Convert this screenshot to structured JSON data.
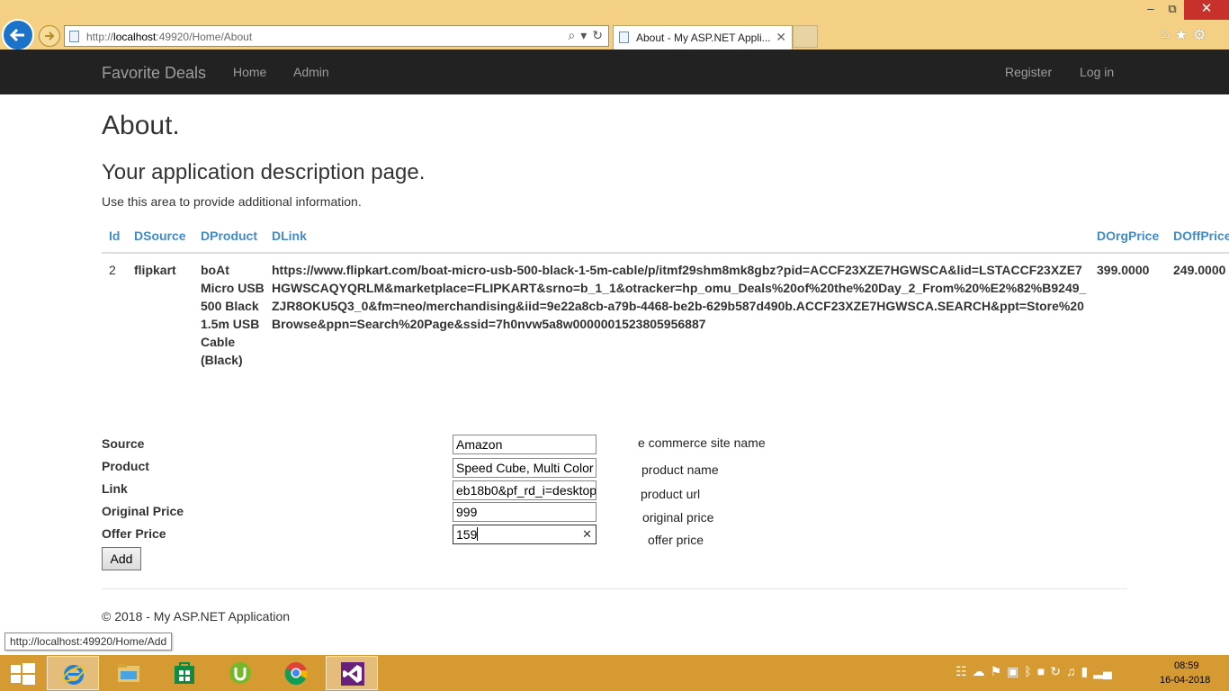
{
  "browser": {
    "url_prefix": "http://",
    "url_host": "localhost",
    "url_rest": ":49920/Home/About",
    "tab_title": "About - My ASP.NET Appli...",
    "status_url": "http://localhost:49920/Home/Add"
  },
  "navbar": {
    "brand": "Favorite Deals",
    "links": [
      "Home",
      "Admin"
    ],
    "right_links": [
      "Register",
      "Log in"
    ]
  },
  "main": {
    "title": "About.",
    "subtitle": "Your application description page.",
    "info": "Use this area to provide additional information."
  },
  "table": {
    "headers": [
      "Id",
      "DSource",
      "DProduct",
      "DLink",
      "DOrgPrice",
      "DOffPrice"
    ],
    "rows": [
      {
        "id": "2",
        "source": "flipkart",
        "product": "boAt Micro USB 500 Black 1.5m USB Cable (Black)",
        "link": "https://www.flipkart.com/boat-micro-usb-500-black-1-5m-cable/p/itmf29shm8mk8gbz?pid=ACCF23XZE7HGWSCA&lid=LSTACCF23XZE7HGWSCAQYQRLM&marketplace=FLIPKART&srno=b_1_1&otracker=hp_omu_Deals%20of%20the%20Day_2_From%20%E2%82%B9249_ZJR8OKU5Q3_0&fm=neo/merchandising&iid=9e22a8cb-a79b-4468-be2b-629b587d490b.ACCF23XZE7HGWSCA.SEARCH&ppt=Store%20Browse&ppn=Search%20Page&ssid=7h0nvw5a8w0000001523805956887",
        "org_price": "399.0000",
        "off_price": "249.0000"
      }
    ]
  },
  "form": {
    "source": {
      "label": "Source",
      "value": "Amazon",
      "hint": "e commerce site name"
    },
    "product": {
      "label": "Product",
      "value": "Speed Cube, Multi Color",
      "hint": "product name"
    },
    "link": {
      "label": "Link",
      "value": "eb18b0&pf_rd_i=desktop",
      "hint": "product url"
    },
    "original_price": {
      "label": "Original Price",
      "value": "999",
      "hint": "original price"
    },
    "offer_price": {
      "label": "Offer Price",
      "value": "159",
      "hint": "offer price"
    },
    "add_label": "Add"
  },
  "footer": {
    "text": "© 2018 - My ASP.NET Application"
  },
  "taskbar": {
    "apps": [
      "internet-explorer",
      "file-explorer",
      "store",
      "utorrent",
      "chrome",
      "visual-studio"
    ],
    "time": "08:59",
    "date": "16-04-2018"
  },
  "colors": {
    "navbar": "#222222",
    "link": "#428bca",
    "chrome": "#f3d083",
    "taskbar": "#d69a33"
  }
}
